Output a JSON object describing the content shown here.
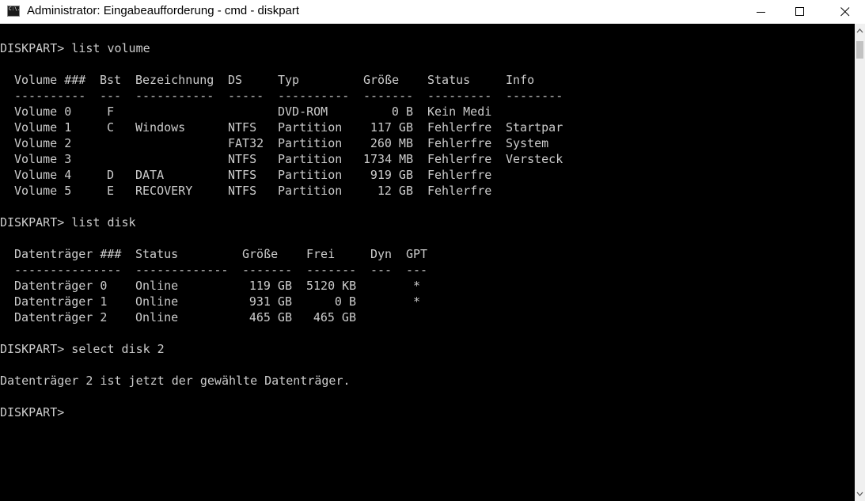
{
  "window": {
    "title": "Administrator: Eingabeaufforderung - cmd - diskpart",
    "icon": "cmd-icon",
    "icon_text": "C:\\."
  },
  "controls": {
    "minimize": "minimize-icon",
    "maximize": "maximize-icon",
    "close": "close-icon"
  },
  "console": {
    "prompt1": "DISKPART> list volume",
    "volume_headers": [
      "Volume ###",
      "Bst",
      "Bezeichnung",
      "DS",
      "Typ",
      "Größe",
      "Status",
      "Info"
    ],
    "volume_separators": [
      "----------",
      "---",
      "-----------",
      "-----",
      "----------",
      "-------",
      "---------",
      "--------"
    ],
    "volumes": [
      [
        "Volume 0",
        "F",
        "",
        "",
        "DVD-ROM",
        "0 B",
        "Kein Medi",
        ""
      ],
      [
        "Volume 1",
        "C",
        "Windows",
        "NTFS",
        "Partition",
        "117 GB",
        "Fehlerfre",
        "Startpar"
      ],
      [
        "Volume 2",
        "",
        "",
        "FAT32",
        "Partition",
        "260 MB",
        "Fehlerfre",
        "System"
      ],
      [
        "Volume 3",
        "",
        "",
        "NTFS",
        "Partition",
        "1734 MB",
        "Fehlerfre",
        "Versteck"
      ],
      [
        "Volume 4",
        "D",
        "DATA",
        "NTFS",
        "Partition",
        "919 GB",
        "Fehlerfre",
        ""
      ],
      [
        "Volume 5",
        "E",
        "RECOVERY",
        "NTFS",
        "Partition",
        "12 GB",
        "Fehlerfre",
        ""
      ]
    ],
    "prompt2": "DISKPART> list disk",
    "disk_headers": [
      "Datenträger ###",
      "Status",
      "Größe",
      "Frei",
      "Dyn",
      "GPT"
    ],
    "disk_separators": [
      "---------------",
      "-------------",
      "-------",
      "-------",
      "---",
      "---"
    ],
    "disks": [
      [
        "Datenträger 0",
        "Online",
        "119 GB",
        "5120 KB",
        "",
        "*"
      ],
      [
        "Datenträger 1",
        "Online",
        "931 GB",
        "0 B",
        "",
        "*"
      ],
      [
        "Datenträger 2",
        "Online",
        "465 GB",
        "465 GB",
        "",
        ""
      ]
    ],
    "prompt3": "DISKPART> select disk 2",
    "message": "Datenträger 2 ist jetzt der gewählte Datenträger.",
    "prompt4": "DISKPART>"
  }
}
